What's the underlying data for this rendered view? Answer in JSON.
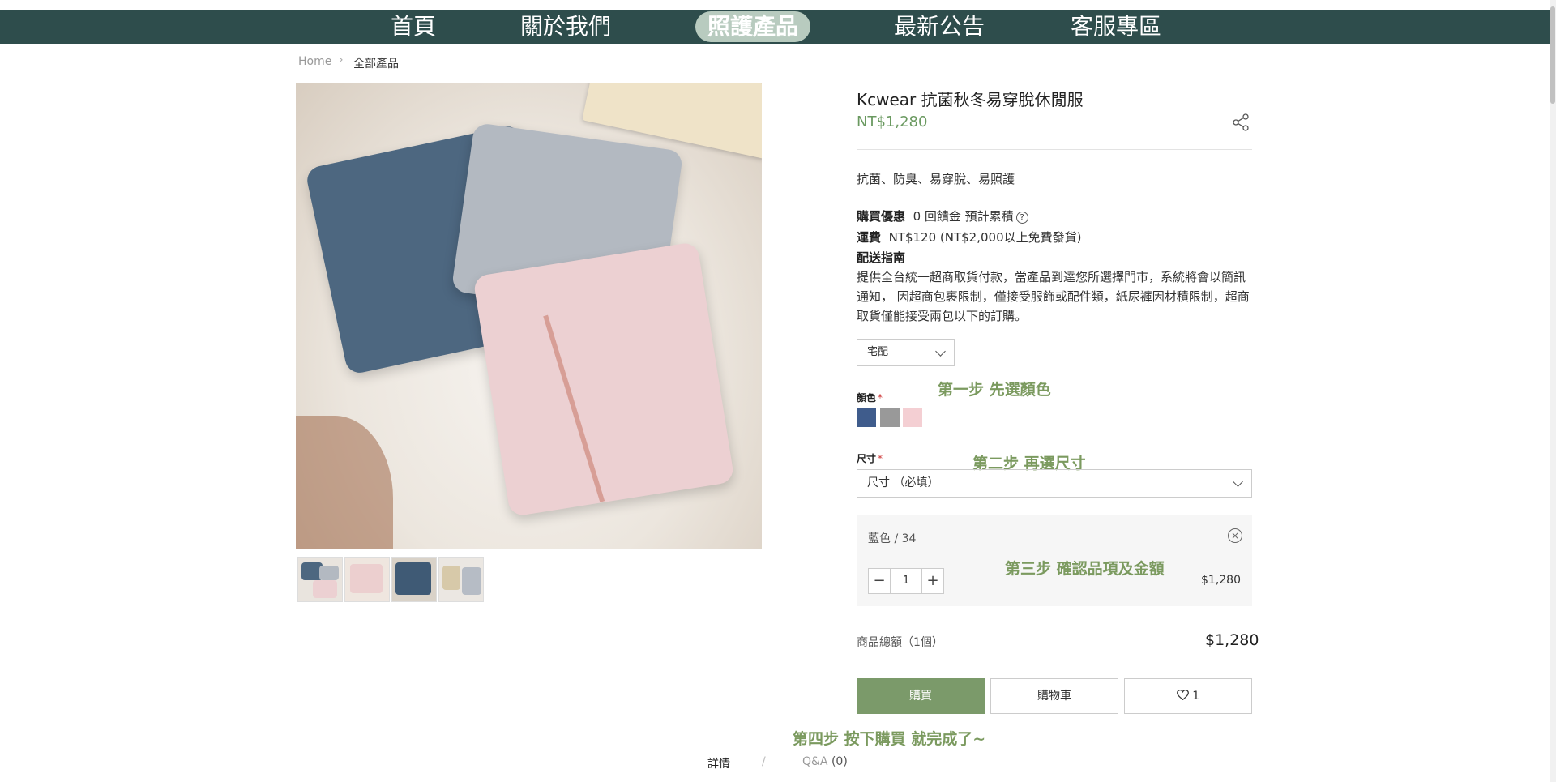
{
  "nav": {
    "items": [
      {
        "label": "首頁",
        "active": false
      },
      {
        "label": "關於我們",
        "active": false
      },
      {
        "label": "照護產品",
        "active": true
      },
      {
        "label": "最新公告",
        "active": false
      },
      {
        "label": "客服專區",
        "active": false
      }
    ]
  },
  "breadcrumb": {
    "home": "Home",
    "current": "全部產品"
  },
  "product": {
    "title": "Kcwear 抗菌秋冬易穿脫休閒服",
    "price": "NT$1,280",
    "features": "抗菌、防臭、易穿脫、易照護",
    "promo_label": "購買優惠",
    "promo_value": "0 回饋金 預計累積",
    "shipping_label": "運費",
    "shipping_value": "NT$120 (NT$2,000以上免費發貨)",
    "delivery_label": "配送指南",
    "delivery_desc": "提供全台統一超商取貨付款，當產品到達您所選擇門市，系統將會以簡訊通知， 因超商包裹限制，僅接受服飾或配件類，紙尿褲因材積限制，超商取貨僅能接受兩包以下的訂購。",
    "delivery_select": "宅配",
    "color_label": "顏色",
    "colors": [
      "#3f5c8c",
      "#999999",
      "#f4cfd3"
    ],
    "size_label": "尺寸",
    "size_placeholder": "尺寸 （必填）",
    "variant": {
      "name": "藍色 / 34",
      "qty": "1",
      "price": "$1,280"
    },
    "total_label": "商品總額（1個）",
    "total_value": "$1,280",
    "buy_label": "購買",
    "cart_label": "購物車",
    "fav_count": "1",
    "required_mark": "*"
  },
  "steps": {
    "step1": "第一步 先選顏色",
    "step2": "第二步 再選尺寸",
    "step3": "第三步 確認品項及金額",
    "step4": "第四步 按下購買 就完成了~"
  },
  "tabs": {
    "detail": "詳情",
    "sep": "/",
    "qa": "Q&A",
    "qa_count": "(0)"
  },
  "colors": {
    "nav_bg": "#2e4d4c",
    "accent": "#7b9a6a",
    "price": "#6a9960",
    "step": "#7b9a5f"
  }
}
